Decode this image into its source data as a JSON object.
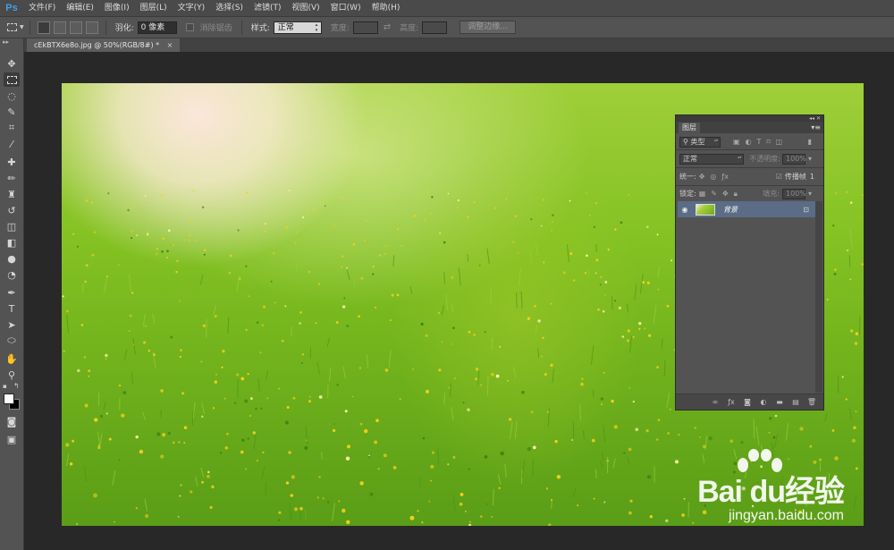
{
  "app": {
    "logo": "Ps",
    "menus": [
      "文件(F)",
      "编辑(E)",
      "图像(I)",
      "图层(L)",
      "文字(Y)",
      "选择(S)",
      "滤镜(T)",
      "视图(V)",
      "窗口(W)",
      "帮助(H)"
    ]
  },
  "options": {
    "feather_label": "羽化:",
    "feather_value": "0 像素",
    "antialias_label": "消除锯齿",
    "style_label": "样式:",
    "style_value": "正常",
    "width_label": "宽度:",
    "height_label": "高度:",
    "refine_edge_button": "调整边缘..."
  },
  "document": {
    "tab_title": "cEkBTX6e8o.jpg @ 50%(RGB/8#) *",
    "close_glyph": "×"
  },
  "layers_panel": {
    "tab_label": "图层",
    "filter_kind": "类型",
    "blend_mode": "正常",
    "opacity_label": "不透明度:",
    "opacity_value": "100%",
    "unify_label": "统一:",
    "propagate_label": "传播帧",
    "propagate_value": "1",
    "lock_label": "锁定:",
    "fill_label": "填充:",
    "fill_value": "100%",
    "layers": [
      {
        "name": "背景",
        "visible": true,
        "locked": true
      }
    ],
    "bottom_icons": [
      "link-icon",
      "fx-icon",
      "mask-icon",
      "adjustment-icon",
      "group-icon",
      "new-layer-icon",
      "trash-icon"
    ]
  },
  "tools": [
    "move-tool",
    "marquee-tool",
    "lasso-tool",
    "quick-select-tool",
    "crop-tool",
    "eyedropper-tool",
    "healing-tool",
    "brush-tool",
    "clone-stamp-tool",
    "history-brush-tool",
    "eraser-tool",
    "gradient-tool",
    "blur-tool",
    "dodge-tool",
    "pen-tool",
    "type-tool",
    "path-select-tool",
    "shape-tool",
    "hand-tool",
    "zoom-tool"
  ],
  "colors": {
    "foreground": "#ffffff",
    "background": "#000000",
    "accent": "#3f9fe8",
    "selected_layer": "#5a6c86"
  },
  "watermark": {
    "brand": "Bai du经验",
    "url": "jingyan.baidu.com"
  }
}
